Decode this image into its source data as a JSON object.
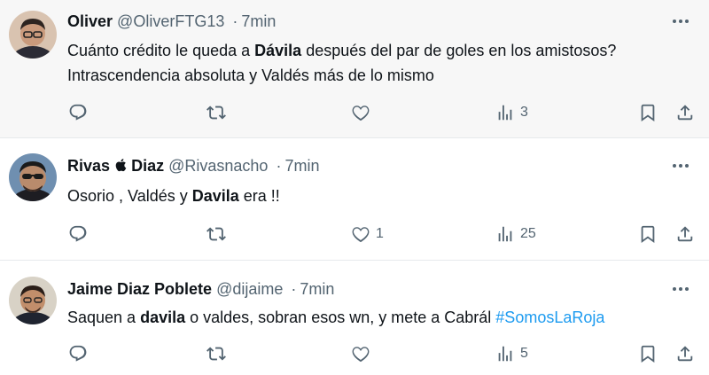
{
  "tweets": [
    {
      "name": "Oliver",
      "name_suffix": "",
      "handle": "@OliverFTG13",
      "dot": "·",
      "time": "7min",
      "text": [
        {
          "t": "Cuánto crédito le queda a ",
          "b": false
        },
        {
          "t": "Dávila",
          "b": true
        },
        {
          "t": " después del par de goles en los amistosos? Intrascendencia absoluta y Valdés más de lo mismo",
          "b": false
        }
      ],
      "likes": "",
      "views": "3"
    },
    {
      "name": "Rivas",
      "name_suffix": "Diaz",
      "handle": "@Rivasnacho",
      "dot": "·",
      "time": "7min",
      "text": [
        {
          "t": "Osorio , Valdés y ",
          "b": false
        },
        {
          "t": "Davila",
          "b": true
        },
        {
          "t": " era !!",
          "b": false
        }
      ],
      "likes": "1",
      "views": "25"
    },
    {
      "name": "Jaime Diaz Poblete",
      "name_suffix": "",
      "handle": "@dijaime",
      "dot": "·",
      "time": "7min",
      "text": [
        {
          "t": "Saquen a ",
          "b": false
        },
        {
          "t": "davila",
          "b": true
        },
        {
          "t": " o valdes, sobran esos wn, y mete a Cabrál ",
          "b": false
        }
      ],
      "hashtag": "#SomosLaRoja",
      "likes": "",
      "views": "5"
    }
  ],
  "icons": [
    "avatar",
    "more-icon",
    "reply-icon",
    "retweet-icon",
    "like-icon",
    "views-icon",
    "bookmark-icon",
    "share-icon",
    "apple-icon"
  ],
  "colors": {
    "text": "#0f1419",
    "muted": "#536471",
    "hashtag": "#1d9bf0",
    "first_bg": "#f7f7f7",
    "divider": "#e6e9ec"
  }
}
